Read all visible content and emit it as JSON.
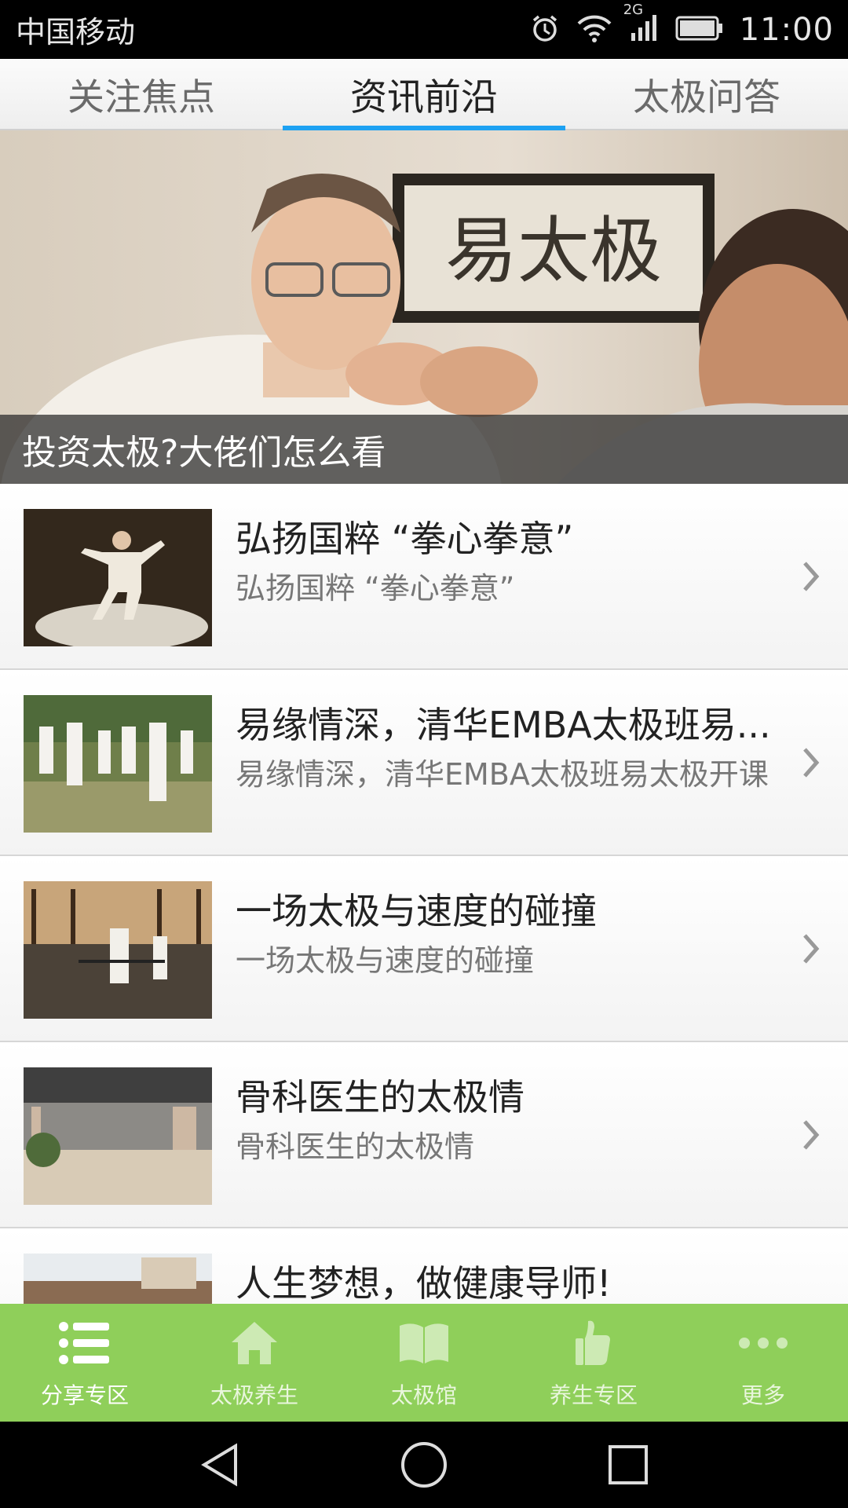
{
  "status_bar": {
    "carrier": "中国移动",
    "network": "2G",
    "time": "11:00"
  },
  "tabs": [
    {
      "label": "关注焦点",
      "active": false
    },
    {
      "label": "资讯前沿",
      "active": true
    },
    {
      "label": "太极问答",
      "active": false
    }
  ],
  "hero": {
    "caption": "投资太极?大佬们怎么看",
    "calligraphy": "易太极"
  },
  "news": [
    {
      "title": "弘扬国粹 “拳心拳意”",
      "subtitle": "弘扬国粹 “拳心拳意”"
    },
    {
      "title": "易缘情深，清华EMBA太极班易...",
      "subtitle": "易缘情深，清华EMBA太极班易太极开课"
    },
    {
      "title": "一场太极与速度的碰撞",
      "subtitle": "一场太极与速度的碰撞"
    },
    {
      "title": "骨科医生的太极情",
      "subtitle": "骨科医生的太极情"
    },
    {
      "title": "人生梦想，做健康导师!",
      "subtitle": ""
    }
  ],
  "bottom_nav": [
    {
      "label": "分享专区",
      "icon": "list-icon",
      "active": true
    },
    {
      "label": "太极养生",
      "icon": "home-icon",
      "active": false
    },
    {
      "label": "太极馆",
      "icon": "book-icon",
      "active": false
    },
    {
      "label": "养生专区",
      "icon": "thumbs-up-icon",
      "active": false
    },
    {
      "label": "更多",
      "icon": "more-icon",
      "active": false
    }
  ],
  "colors": {
    "tab_indicator": "#1da1f2",
    "bottom_nav_bg": "#8fcf5a"
  }
}
